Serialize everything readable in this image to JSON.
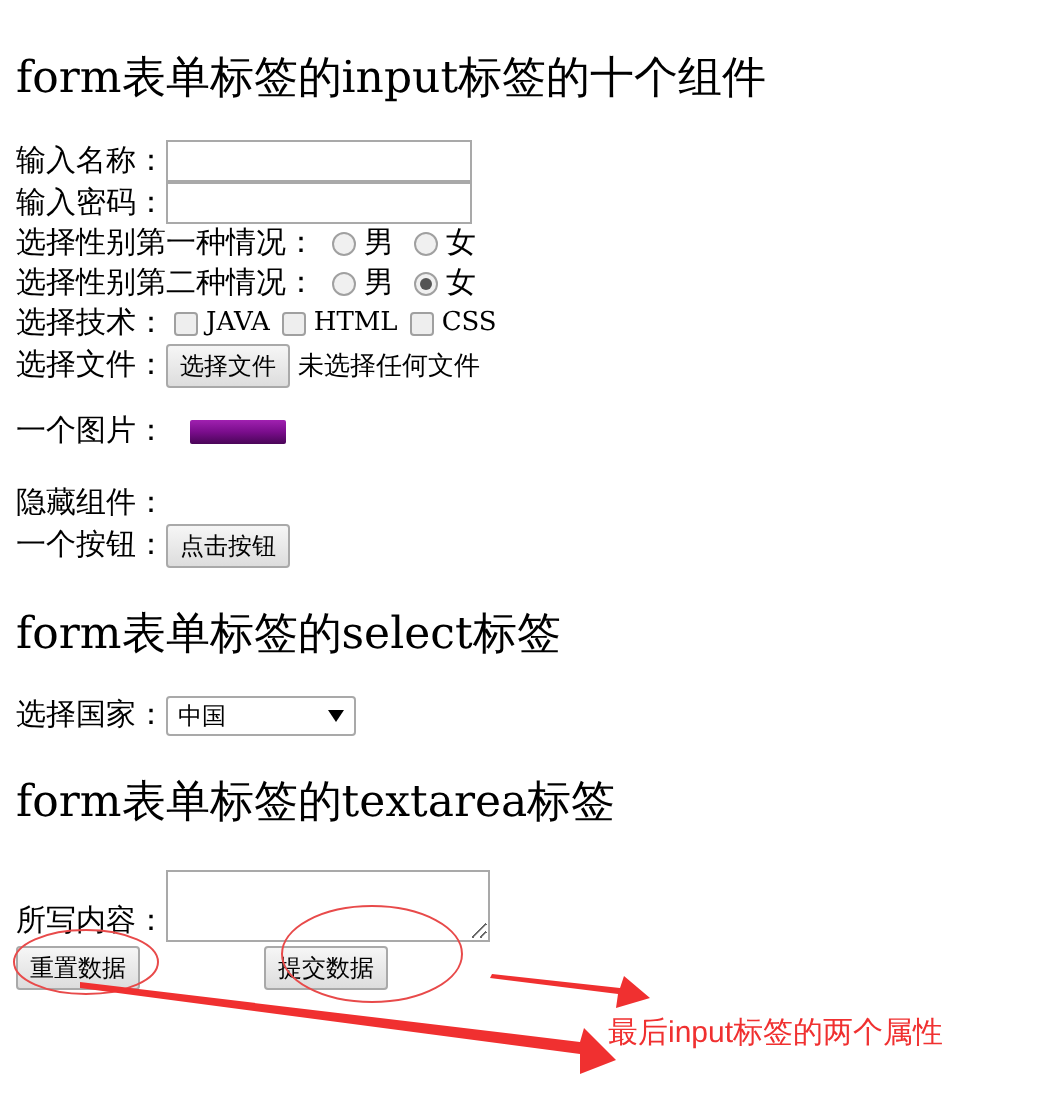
{
  "sections": [
    {
      "title": "form表单标签的input标签的十个组件",
      "rows": [
        {
          "kind": "text",
          "label": "输入名称："
        },
        {
          "kind": "password",
          "label": "输入密码："
        },
        {
          "kind": "radio",
          "label": "选择性别第一种情况：",
          "options": [
            {
              "label": "男",
              "selected": false
            },
            {
              "label": "女",
              "selected": false
            }
          ]
        },
        {
          "kind": "radio",
          "label": "选择性别第二种情况：",
          "options": [
            {
              "label": "男",
              "selected": false
            },
            {
              "label": "女",
              "selected": true
            }
          ]
        },
        {
          "kind": "checkbox",
          "label": "选择技术：",
          "options": [
            {
              "label": "JAVA",
              "checked": false
            },
            {
              "label": "HTML",
              "checked": false
            },
            {
              "label": "CSS",
              "checked": false
            }
          ]
        },
        {
          "kind": "file",
          "label": "选择文件：",
          "button": "选择文件",
          "status": "未选择任何文件"
        },
        {
          "kind": "image",
          "label": "一个图片："
        },
        {
          "kind": "hidden",
          "label": "隐藏组件："
        },
        {
          "kind": "button",
          "label": "一个按钮：",
          "button": "点击按钮"
        }
      ]
    },
    {
      "title": "form表单标签的select标签",
      "rows": [
        {
          "kind": "select",
          "label": "选择国家：",
          "value": "中国"
        }
      ]
    },
    {
      "title": "form表单标签的textarea标签",
      "rows": [
        {
          "kind": "textarea",
          "label": "所写内容："
        }
      ]
    }
  ],
  "form_buttons": [
    {
      "label": "重置数据"
    },
    {
      "label": "提交数据"
    }
  ],
  "annotation": {
    "text": "最后input标签的两个属性"
  }
}
